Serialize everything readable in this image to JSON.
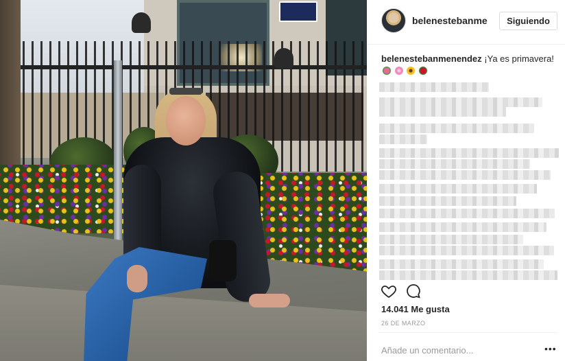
{
  "post": {
    "photo_alt": "woman-sitting-by-flowerbed"
  },
  "header": {
    "username": "belenestebanmenendez",
    "follow_label": "Siguiendo"
  },
  "caption": {
    "username": "belenestebanmenendez",
    "text": "¡Ya es primavera!",
    "emojis": [
      "tulip-icon",
      "blossom-icon",
      "sunflower-icon",
      "rose-icon"
    ]
  },
  "footer": {
    "likes": "14.041 Me gusta",
    "date": "26 DE MARZO",
    "comment_placeholder": "Añade un comentario...",
    "more_label": "•••"
  },
  "colors": {
    "text": "#262626",
    "muted": "#999999",
    "border": "#dbdbdb",
    "divider": "#efefef"
  }
}
